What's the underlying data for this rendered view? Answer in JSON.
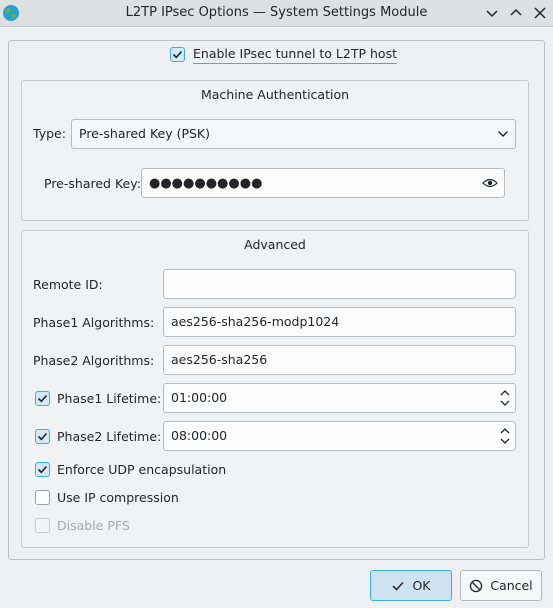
{
  "window": {
    "title": "L2TP IPsec Options — System Settings Module",
    "app_icon": "globe-icon",
    "controls": [
      "minimize-icon",
      "maximize-icon",
      "close-icon"
    ]
  },
  "enable_ipsec": {
    "label": "Enable IPsec tunnel to L2TP host",
    "checked": true
  },
  "machine_auth": {
    "title": "Machine Authentication",
    "type_label": "Type:",
    "type_value": "Pre-shared Key (PSK)",
    "psk_label": "Pre-shared Key:",
    "psk_masked": "●●●●●●●●●●"
  },
  "advanced": {
    "title": "Advanced",
    "remote_id_label": "Remote ID:",
    "remote_id_value": "",
    "phase1_alg_label": "Phase1 Algorithms:",
    "phase1_alg_value": "aes256-sha256-modp1024",
    "phase2_alg_label": "Phase2 Algorithms:",
    "phase2_alg_value": "aes256-sha256",
    "phase1_life_label": "Phase1 Lifetime:",
    "phase1_life_value": "01:00:00",
    "phase1_life_checked": true,
    "phase2_life_label": "Phase2 Lifetime:",
    "phase2_life_value": "08:00:00",
    "phase2_life_checked": true,
    "udp_label": "Enforce UDP encapsulation",
    "udp_checked": true,
    "ipcomp_label": "Use IP compression",
    "ipcomp_checked": false,
    "pfs_label": "Disable PFS",
    "pfs_checked": false,
    "pfs_disabled": true
  },
  "buttons": {
    "ok": "OK",
    "cancel": "Cancel"
  },
  "colors": {
    "accent": "#3daee9",
    "window_bg": "#eff0f1",
    "text": "#232629"
  }
}
